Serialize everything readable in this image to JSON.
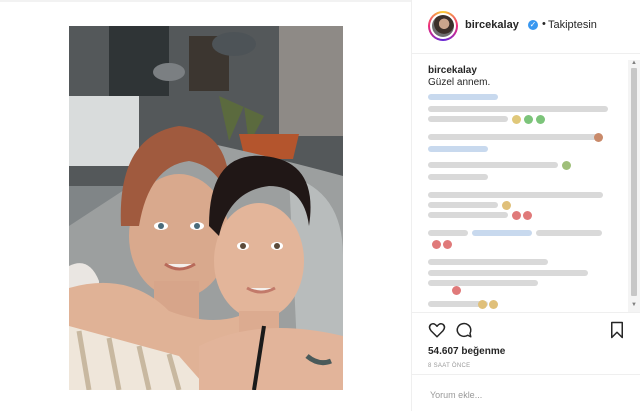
{
  "post": {
    "username": "bircekalay",
    "follow_label": "Takiptesin",
    "dot": "•",
    "verified_icon": "verified-badge-icon"
  },
  "caption": {
    "username": "bircekalay",
    "text": "Güzel annem."
  },
  "actions": {
    "like_icon": "heart-icon",
    "comment_icon": "comment-icon",
    "save_icon": "bookmark-icon"
  },
  "likes": "54.607 beğenme",
  "timestamp": "8 SAAT ÖNCE",
  "comment_box": {
    "placeholder": "Yorum ekle..."
  },
  "colors": {
    "verified": "#3897f0",
    "text": "#262626",
    "muted": "#999999",
    "border": "#efefef"
  }
}
